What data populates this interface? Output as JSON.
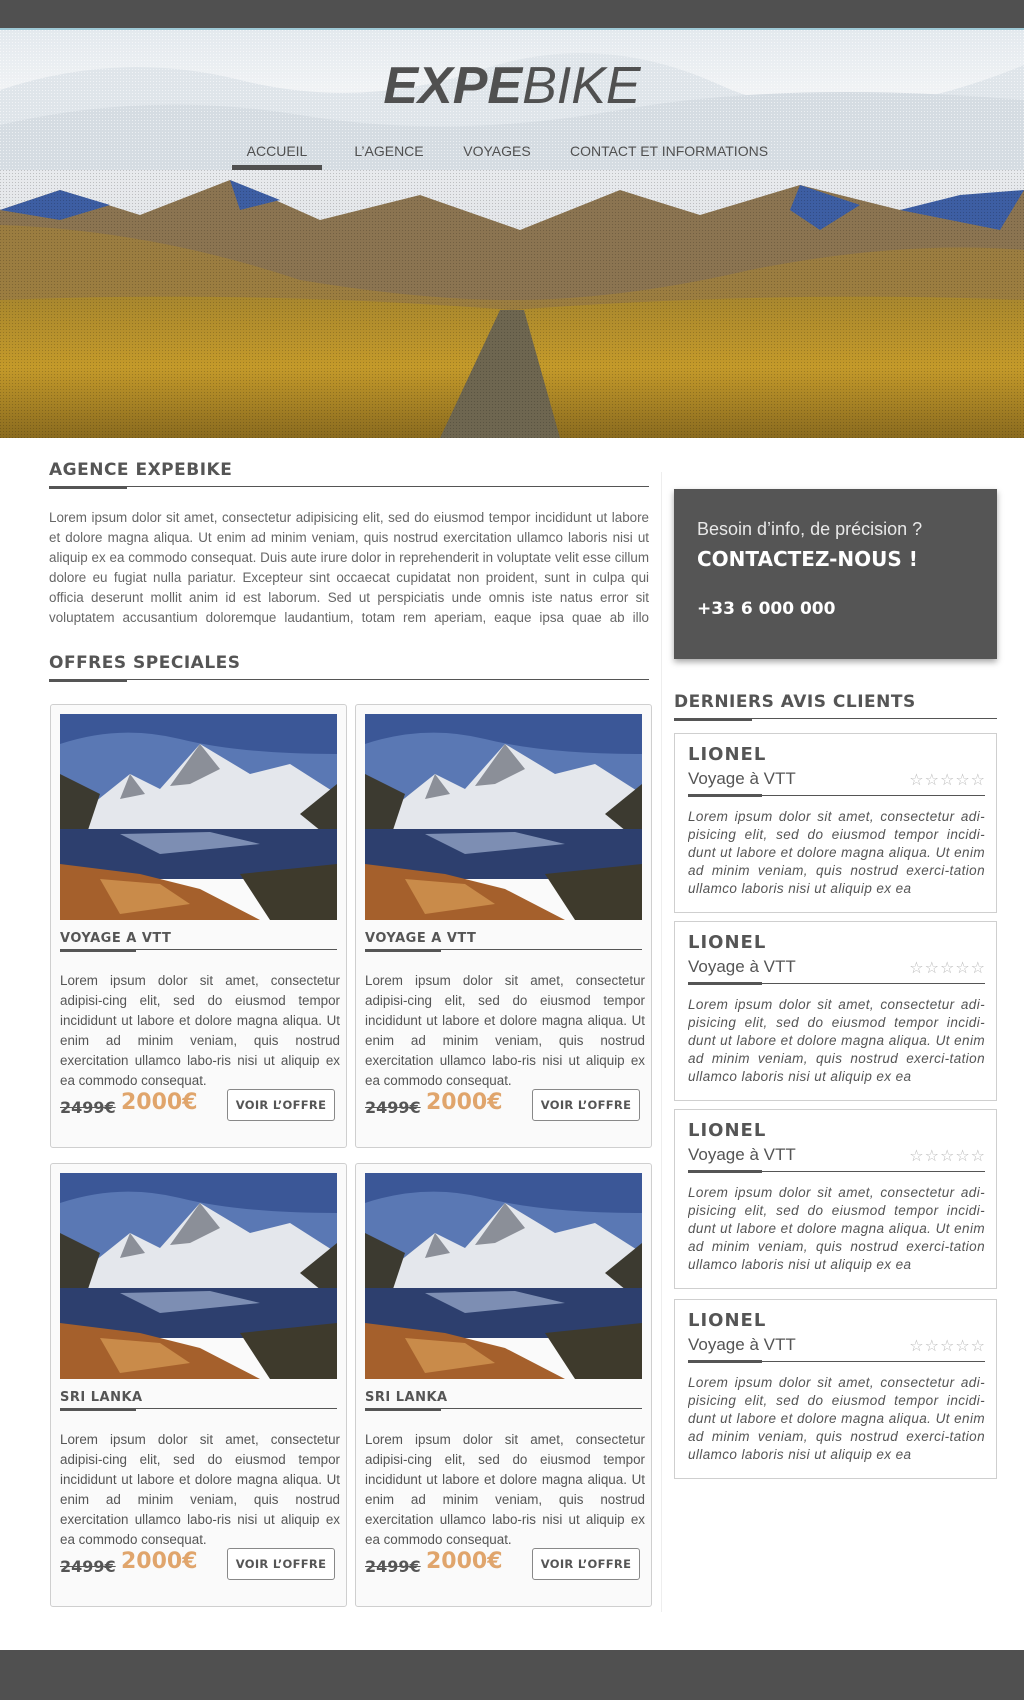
{
  "brand": {
    "part1": "EXPE",
    "part2": "BIKE"
  },
  "nav": {
    "items": [
      {
        "label": "ACCUEIL",
        "active": true
      },
      {
        "label": "L’AGENCE",
        "active": false
      },
      {
        "label": "VOYAGES",
        "active": false
      },
      {
        "label": "CONTACT ET INFORMATIONS",
        "active": false
      }
    ]
  },
  "agency": {
    "title": "AGENCE EXPEBIKE",
    "text": "Lorem ipsum dolor sit amet, consectetur adipisicing elit, sed do eiusmod tempor incididunt ut labore et dolore magna aliqua. Ut enim ad minim veniam, quis nostrud exercitation ullamco laboris nisi ut aliquip ex ea commodo consequat. Duis aute irure dolor in reprehenderit in voluptate velit esse cillum dolore eu fugiat nulla pariatur. Excepteur sint occaecat cupidatat non proident, sunt in culpa qui officia deserunt mollit anim id est laborum. Sed ut perspiciatis unde omnis iste natus error sit voluptatem accusantium doloremque laudantium, totam rem aperiam, eaque ipsa quae ab illo inventore veritatis et quasi archi-"
  },
  "offers": {
    "title": "OFFRES SPECIALES",
    "cards": [
      {
        "title": "VOYAGE A VTT",
        "text": "Lorem ipsum dolor sit amet, consectetur adipisi-cing elit, sed do eiusmod tempor incididunt ut labore et dolore magna aliqua. Ut enim ad minim veniam, quis nostrud exercitation ullamco labo-ris nisi ut aliquip ex ea commodo consequat.",
        "old_price": "2499€",
        "new_price": "2000€",
        "button": "VOIR L’OFFRE"
      },
      {
        "title": "VOYAGE A VTT",
        "text": "Lorem ipsum dolor sit amet, consectetur adipisi-cing elit, sed do eiusmod tempor incididunt ut labore et dolore magna aliqua. Ut enim ad minim veniam, quis nostrud exercitation ullamco labo-ris nisi ut aliquip ex ea commodo consequat.",
        "old_price": "2499€",
        "new_price": "2000€",
        "button": "VOIR L’OFFRE"
      },
      {
        "title": "SRI LANKA",
        "text": "Lorem ipsum dolor sit amet, consectetur adipisi-cing elit, sed do eiusmod tempor incididunt ut labore et dolore magna aliqua. Ut enim ad minim veniam, quis nostrud exercitation ullamco labo-ris nisi ut aliquip ex ea commodo consequat.",
        "old_price": "2499€",
        "new_price": "2000€",
        "button": "VOIR L’OFFRE"
      },
      {
        "title": "SRI LANKA",
        "text": "Lorem ipsum dolor sit amet, consectetur adipisi-cing elit, sed do eiusmod tempor incididunt ut labore et dolore magna aliqua. Ut enim ad minim veniam, quis nostrud exercitation ullamco labo-ris nisi ut aliquip ex ea commodo consequat.",
        "old_price": "2499€",
        "new_price": "2000€",
        "button": "VOIR L’OFFRE"
      }
    ]
  },
  "contact": {
    "question": "Besoin d’info, de précision ?",
    "cta": "CONTACTEZ-NOUS !",
    "phone": "+33 6 000 000"
  },
  "reviews": {
    "title": "DERNIERS AVIS CLIENTS",
    "items": [
      {
        "name": "LIONEL",
        "trip": "Voyage à VTT",
        "stars": "☆☆☆☆☆",
        "rating": 0,
        "text": "Lorem ipsum dolor sit amet, consectetur adi-pisicing elit, sed do eiusmod tempor incidi-dunt ut labore et dolore magna aliqua. Ut enim ad minim veniam, quis nostrud exerci-tation ullamco laboris nisi ut aliquip ex ea"
      },
      {
        "name": "LIONEL",
        "trip": "Voyage à VTT",
        "stars": "☆☆☆☆☆",
        "rating": 0,
        "text": "Lorem ipsum dolor sit amet, consectetur adi-pisicing elit, sed do eiusmod tempor incidi-dunt ut labore et dolore magna aliqua. Ut enim ad minim veniam, quis nostrud exerci-tation ullamco laboris nisi ut aliquip ex ea"
      },
      {
        "name": "LIONEL",
        "trip": "Voyage à VTT",
        "stars": "☆☆☆☆☆",
        "rating": 0,
        "text": "Lorem ipsum dolor sit amet, consectetur adi-pisicing elit, sed do eiusmod tempor incidi-dunt ut labore et dolore magna aliqua. Ut enim ad minim veniam, quis nostrud exerci-tation ullamco laboris nisi ut aliquip ex ea"
      },
      {
        "name": "LIONEL",
        "trip": "Voyage à VTT",
        "stars": "☆☆☆☆☆",
        "rating": 0,
        "text": "Lorem ipsum dolor sit amet, consectetur adi-pisicing elit, sed do eiusmod tempor incidi-dunt ut labore et dolore magna aliqua. Ut enim ad minim veniam, quis nostrud exerci-tation ullamco laboris nisi ut aliquip ex ea"
      }
    ]
  },
  "colors": {
    "dark": "#505050",
    "price_accent": "#e0a56c",
    "topbar_line": "#9fc9d6"
  }
}
